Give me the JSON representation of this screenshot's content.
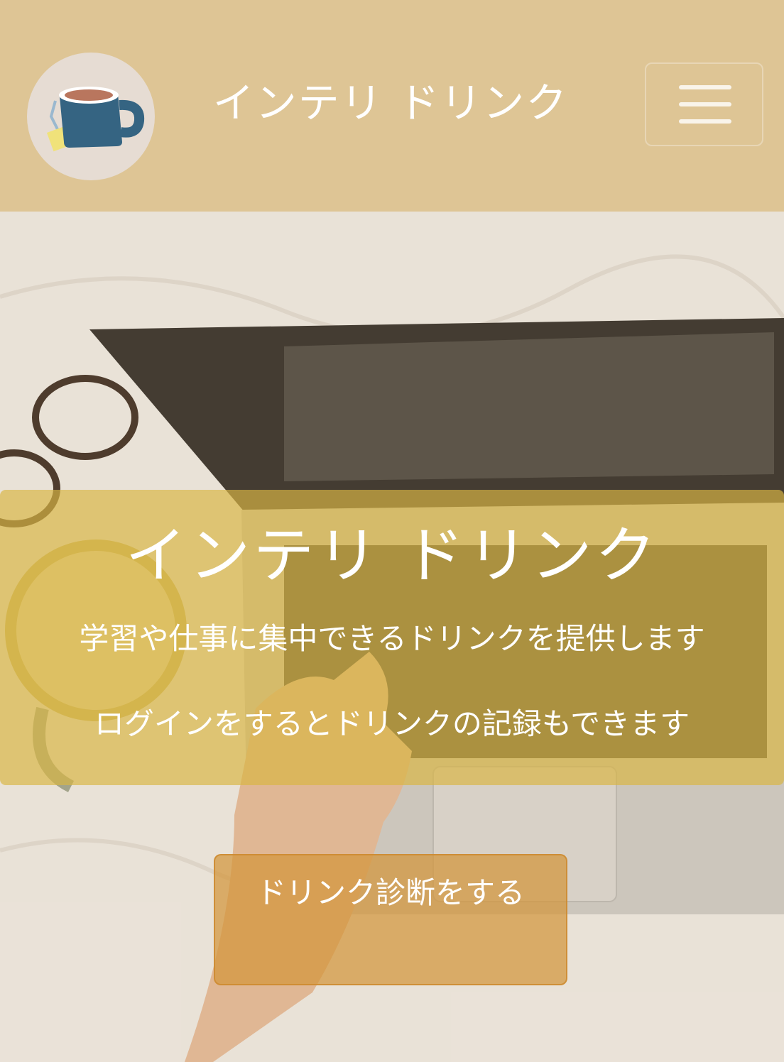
{
  "header": {
    "logo_icon": "tea-cup-icon",
    "brand": "インテリ ドリンク",
    "menu_icon": "hamburger-menu-icon"
  },
  "hero": {
    "title": "インテリ ドリンク",
    "subtitle_1": "学習や仕事に集中できるドリンクを提供します",
    "subtitle_2": "ログインをするとドリンクの記録もできます",
    "cta_label": "ドリンク診断をする"
  },
  "colors": {
    "header_bg": "#dec595",
    "panel_overlay": "#d9b644",
    "cta_bg": "#d2963c"
  }
}
